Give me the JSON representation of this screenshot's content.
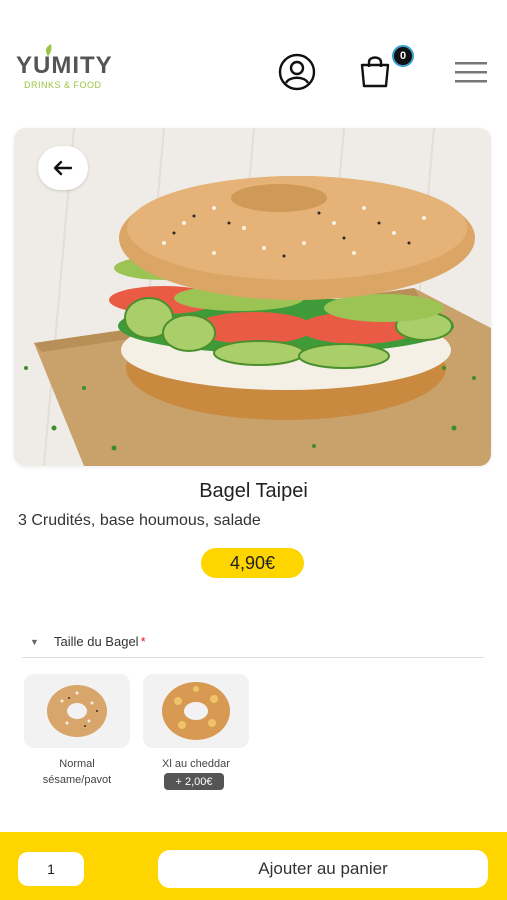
{
  "header": {
    "logo_main": "YUMITY",
    "logo_sub": "DRINKS & FOOD",
    "cart_count": "0",
    "icons": [
      "user-icon",
      "shopping-bag-icon",
      "hamburger-menu-icon"
    ]
  },
  "product": {
    "name": "Bagel Taipei",
    "description": "3 Crudités, base houmous, salade",
    "price": "4,90€",
    "back_icon": "arrow-left-icon"
  },
  "options": {
    "title": "Taille du Bagel",
    "required_mark": "*",
    "choices": [
      {
        "label_line1": "Normal",
        "label_line2": "sésame/pavot",
        "extra": ""
      },
      {
        "label_line1": "Xl au cheddar",
        "label_line2": "",
        "extra": "+ 2,00€"
      }
    ]
  },
  "footer": {
    "quantity": "1",
    "add_label": "Ajouter au panier"
  },
  "colors": {
    "accent": "#ffd500",
    "brand_green": "#9bc53d",
    "required": "#e0202a"
  }
}
